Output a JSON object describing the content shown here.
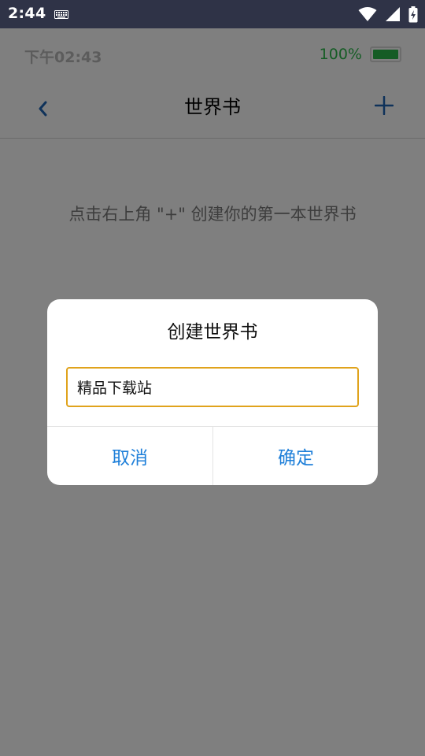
{
  "system_status": {
    "time": "2:44",
    "icons": [
      "keyboard-icon",
      "wifi-icon",
      "cellular-signal-icon",
      "battery-charging-icon"
    ]
  },
  "app_status": {
    "time": "下午02:43",
    "battery_percent": "100%",
    "battery_level": 1.0,
    "battery_color": "#2bb94a"
  },
  "navbar": {
    "title": "世界书",
    "back_icon": "chevron-left-icon",
    "add_icon": "plus-icon",
    "accent_color": "#1e64b4"
  },
  "main": {
    "empty_hint": "点击右上角 \"+\" 创建你的第一本世界书"
  },
  "dialog": {
    "title": "创建世界书",
    "input_value": "精品下载站",
    "cancel_label": "取消",
    "confirm_label": "确定",
    "button_color": "#1e7fd9",
    "input_border_color": "#e0a31c"
  }
}
